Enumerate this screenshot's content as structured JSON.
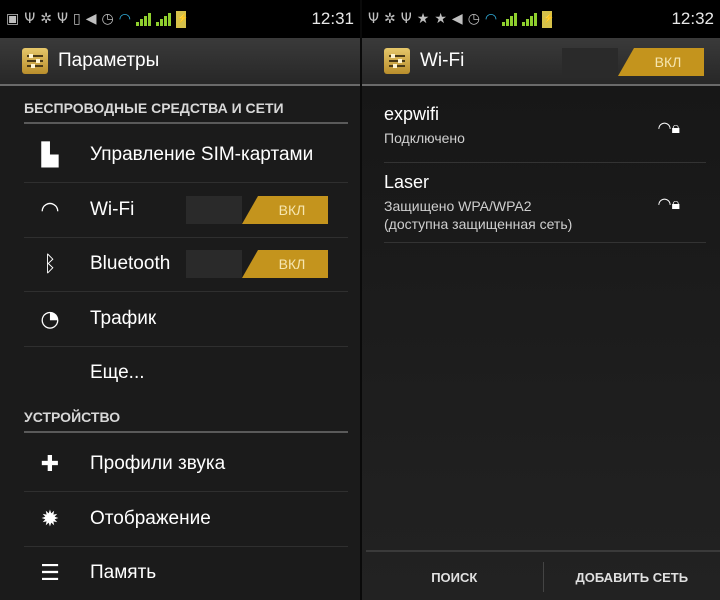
{
  "left": {
    "status_bar": {
      "icons": [
        "image-icon",
        "usb-icon",
        "android-debug-icon",
        "usb-icon",
        "vibrate-icon",
        "volume-icon",
        "alarm-icon",
        "wifi-icon",
        "signal-icon",
        "signal-icon",
        "battery-charging-icon"
      ],
      "time": "12:31"
    },
    "title": "Параметры",
    "sections": {
      "wireless": "БЕСПРОВОДНЫЕ СРЕДСТВА И СЕТИ",
      "device": "УСТРОЙСТВО"
    },
    "items": {
      "sim": "Управление SIM-картами",
      "wifi": "Wi-Fi",
      "wifi_toggle": "ВКЛ",
      "bluetooth": "Bluetooth",
      "bluetooth_toggle": "ВКЛ",
      "traffic": "Трафик",
      "more": "Еще...",
      "sound": "Профили звука",
      "display": "Отображение",
      "storage": "Память"
    }
  },
  "right": {
    "status_bar": {
      "icons": [
        "usb-icon",
        "android-debug-icon",
        "usb-icon",
        "star-icon",
        "star-outline-icon",
        "volume-icon",
        "alarm-icon",
        "wifi-icon",
        "signal-icon",
        "signal-icon",
        "battery-charging-icon"
      ],
      "time": "12:32"
    },
    "title": "Wi-Fi",
    "toggle": "ВКЛ",
    "networks": [
      {
        "ssid": "expwifi",
        "status": "Подключено"
      },
      {
        "ssid": "Laser",
        "status": "Защищено WPA/WPA2",
        "status2": "(доступна защищенная сеть)"
      }
    ],
    "buttons": {
      "search": "ПОИСК",
      "add": "ДОБАВИТЬ СЕТЬ"
    }
  },
  "colors": {
    "accent": "#c4941d",
    "toggle_text": "#f6e6b0",
    "background": "#1b1b1b",
    "clock": "#33b5e5"
  }
}
